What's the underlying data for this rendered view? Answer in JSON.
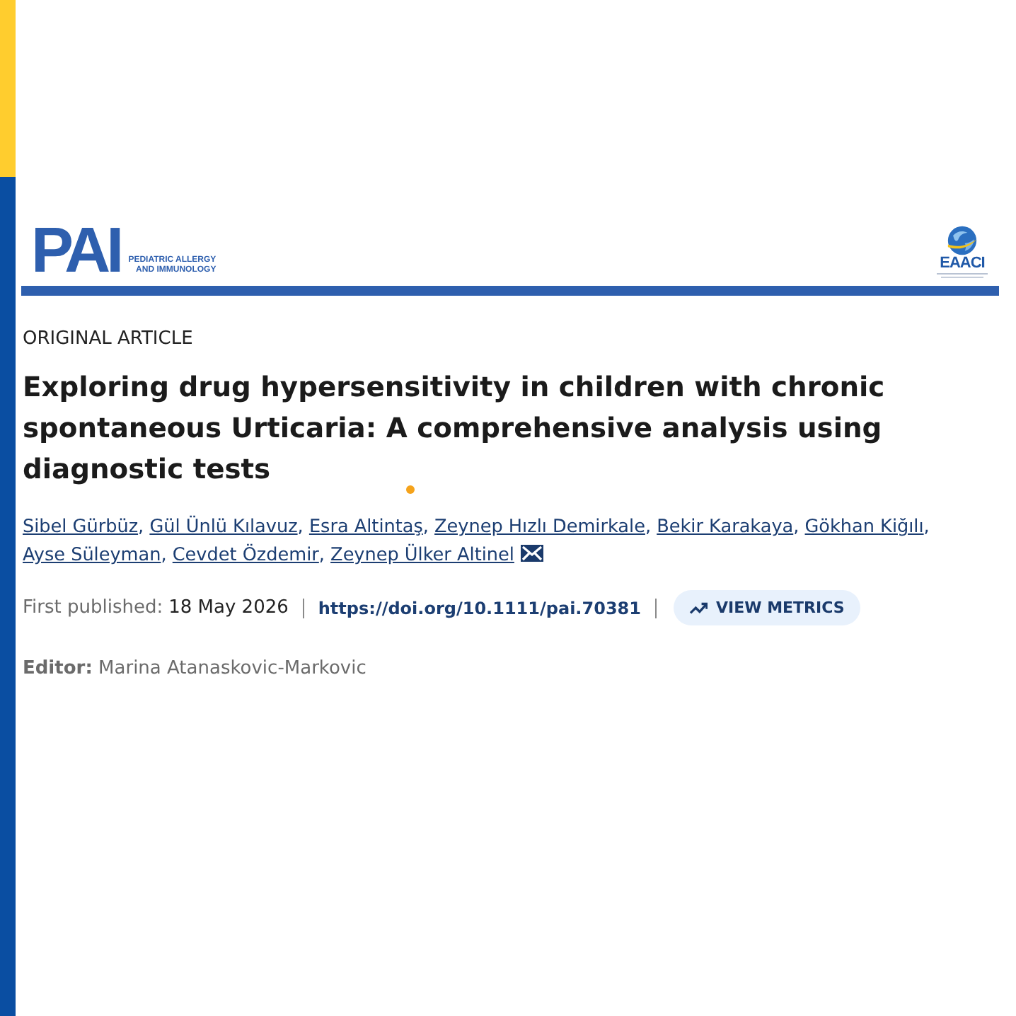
{
  "header": {
    "journal_logo": {
      "abbr": "PAI",
      "tagline": [
        "PEDIATRIC ALLERGY",
        "AND IMMUNOLOGY"
      ]
    },
    "society_logo": {
      "name": "EAACI"
    }
  },
  "article": {
    "type": "ORIGINAL ARTICLE",
    "title": "Exploring drug hypersensitivity in children with chronic spontaneous Urticaria: A comprehensive analysis using diagnostic tests",
    "author_separator": ",",
    "authors": [
      {
        "name": "Sibel Gürbüz",
        "corresponding": false
      },
      {
        "name": "Gül Ünlü Kılavuz",
        "corresponding": false
      },
      {
        "name": "Esra Altintaş",
        "corresponding": false
      },
      {
        "name": "Zeynep Hızlı Demirkale",
        "corresponding": false
      },
      {
        "name": "Bekir Karakaya",
        "corresponding": false
      },
      {
        "name": "Gökhan Kiğılı",
        "corresponding": false
      },
      {
        "name": "Ayse Süleyman",
        "corresponding": false
      },
      {
        "name": "Cevdet Özdemir",
        "corresponding": false
      },
      {
        "name": "Zeynep Ülker Altinel",
        "corresponding": true
      }
    ],
    "first_published": {
      "label": "First published:",
      "date": "18 May 2026"
    },
    "doi": "https://doi.org/10.1111/pai.70381",
    "metrics_button": {
      "label": "VIEW METRICS"
    },
    "editor": "**Editor:** Marina Atanaskovic-Markovic"
  }
}
